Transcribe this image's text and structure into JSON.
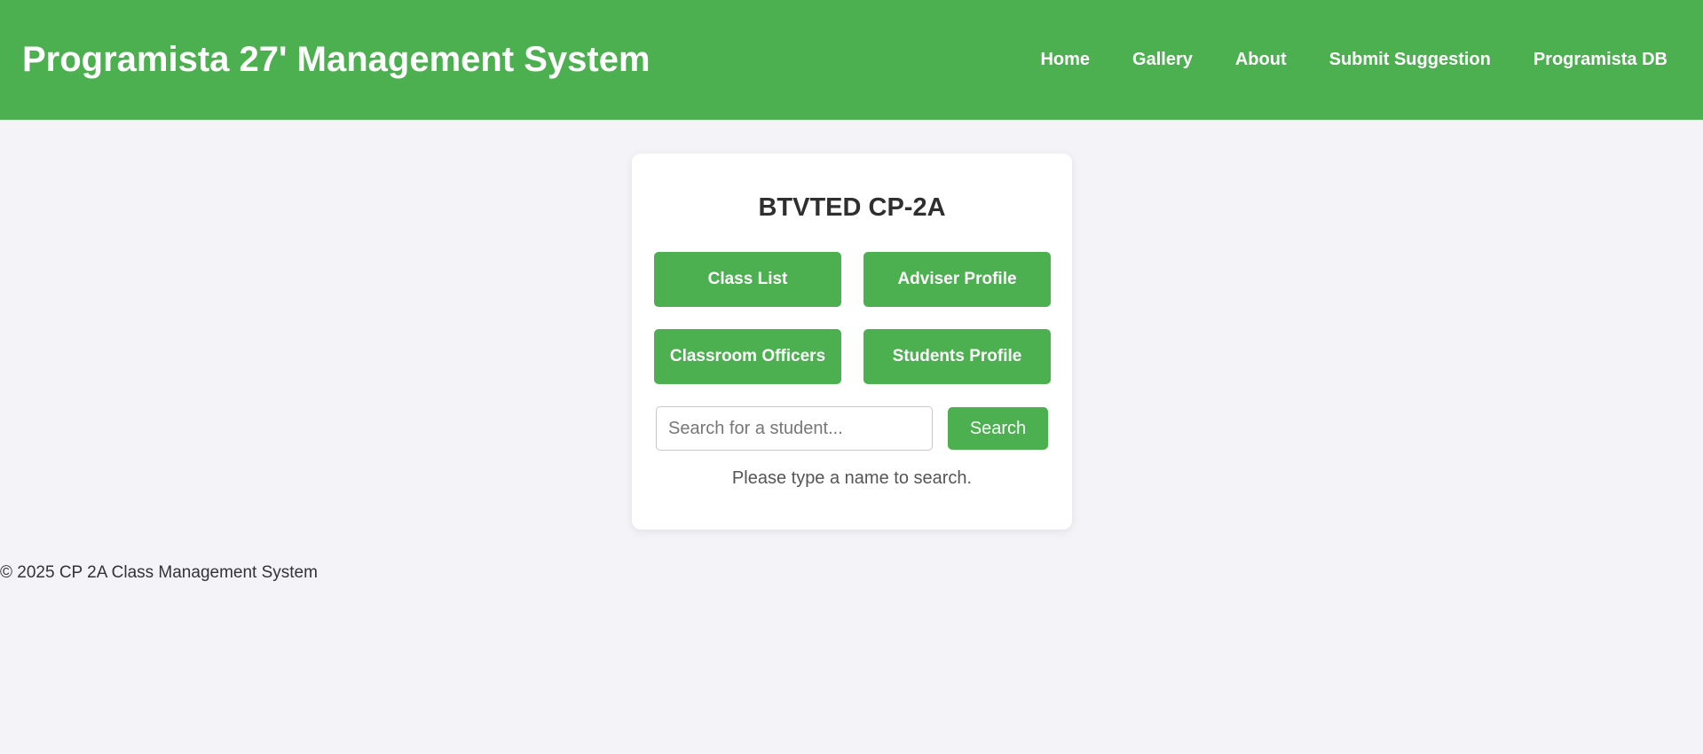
{
  "header": {
    "title": "Programista 27' Management System",
    "nav": [
      "Home",
      "Gallery",
      "About",
      "Submit Suggestion",
      "Programista DB"
    ]
  },
  "card": {
    "title": "BTVTED CP-2A",
    "buttons": {
      "class_list": "Class List",
      "adviser_profile": "Adviser Profile",
      "classroom_officers": "Classroom Officers",
      "students_profile": "Students Profile"
    },
    "search": {
      "placeholder": "Search for a student...",
      "value": "",
      "button_label": "Search",
      "hint": "Please type a name to search."
    }
  },
  "footer": {
    "text": "© 2025 CP 2A Class Management System"
  },
  "colors": {
    "brand_green": "#4caf50",
    "page_background": "#f4f4f8"
  }
}
